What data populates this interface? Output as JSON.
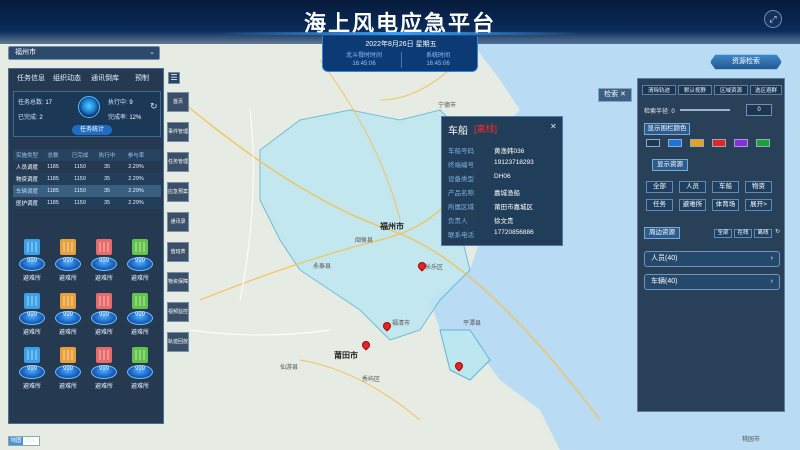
{
  "header": {
    "title": "海上风电应急平台",
    "date": "2022年8月26日 星期五",
    "left_time_label": "北斗授时时间",
    "left_time": "16:45:06",
    "right_time_label": "系统时间",
    "right_time": "16:45:06"
  },
  "city_select": {
    "value": "福州市"
  },
  "left_panel": {
    "tabs": [
      "任务信息",
      "组织动态",
      "通讯倒库",
      "预制"
    ],
    "task": {
      "total_label": "任务总数:",
      "total": "17",
      "running_label": "执行中:",
      "running": "9",
      "done_label": "已完成:",
      "done": "2",
      "rate_label": "完成率:",
      "rate": "12%",
      "stat_button": "任务统计"
    },
    "table": {
      "headers": [
        "实施类型",
        "总数",
        "已完成",
        "执行中",
        "参与率"
      ],
      "rows": [
        [
          "人员调度",
          "1185",
          "1150",
          "35",
          "2.29%"
        ],
        [
          "物资调度",
          "1185",
          "1150",
          "35",
          "2.29%"
        ],
        [
          "车辆调度",
          "1185",
          "1150",
          "35",
          "2.29%"
        ],
        [
          "医护调度",
          "1185",
          "1150",
          "35",
          "2.29%"
        ]
      ]
    },
    "shelters": [
      {
        "num": "999",
        "name": "避难所",
        "color": "#3aa0e8"
      },
      {
        "num": "999",
        "name": "避难所",
        "color": "#e8a03a"
      },
      {
        "num": "999",
        "name": "避难所",
        "color": "#e86a6a"
      },
      {
        "num": "999",
        "name": "避难所",
        "color": "#63c24a"
      },
      {
        "num": "999",
        "name": "避难所",
        "color": "#3aa0e8"
      },
      {
        "num": "999",
        "name": "避难所",
        "color": "#e8a03a"
      },
      {
        "num": "999",
        "name": "避难所",
        "color": "#e86a6a"
      },
      {
        "num": "999",
        "name": "避难所",
        "color": "#63c24a"
      },
      {
        "num": "999",
        "name": "避难所",
        "color": "#3aa0e8"
      },
      {
        "num": "999",
        "name": "避难所",
        "color": "#e8a03a"
      },
      {
        "num": "999",
        "name": "避难所",
        "color": "#e86a6a"
      },
      {
        "num": "999",
        "name": "避难所",
        "color": "#63c24a"
      }
    ]
  },
  "toolbar": [
    "首页",
    "事件管理",
    "任务管理",
    "应急预案",
    "通讯录",
    "值班表",
    "物资保障",
    "视频监控",
    "轨迹回放"
  ],
  "popup": {
    "title": "车船",
    "status": "[离线]",
    "rows": [
      {
        "k": "车船号码",
        "v": "黄渔韩036"
      },
      {
        "k": "终端编号",
        "v": "19123718293"
      },
      {
        "k": "设备类型",
        "v": "DH06"
      },
      {
        "k": "产品名称",
        "v": "嘉城渔船"
      },
      {
        "k": "所属区域",
        "v": "莆田市嘉城区"
      },
      {
        "k": "负责人",
        "v": "徐文贵"
      },
      {
        "k": "联系电话",
        "v": "17720856886"
      }
    ]
  },
  "right_panel": {
    "resource_search": "资源检索",
    "search_btn": "检索",
    "tabs": [
      "清除轨迹",
      "默认视野",
      "区域资源",
      "选区避群"
    ],
    "radius_label": "检索半径:",
    "radius_value": "0",
    "show_color": "显示围栏颜色",
    "colors": [
      "#1a3a5c",
      "#1a74e0",
      "#e6a21f",
      "#e02626",
      "#8a2be2",
      "#19a03a"
    ],
    "show_resource": "显示资源",
    "filters": [
      "全部",
      "人员",
      "车船",
      "物资",
      "任务",
      "避难所",
      "体育场",
      "展开>"
    ],
    "nearby": "周边资源",
    "nearby_filters": [
      "全部",
      "在线",
      "离线"
    ],
    "groups": [
      {
        "label": "人员(40)"
      },
      {
        "label": "车辆(40)"
      }
    ]
  },
  "map_labels": {
    "fuzhou": "福州市",
    "putian": "莆田市",
    "ningde": "宁德市",
    "changle": "长乐区",
    "minhou": "闽侯县",
    "yongtai": "永泰县",
    "fuqing": "福清市",
    "xianyou": "仙游县",
    "pingtan": "平潭县",
    "putian_district": "秀屿区",
    "taoyuan": "桃园市"
  },
  "map_toggle": {
    "a": "地图",
    "b": "混合"
  }
}
